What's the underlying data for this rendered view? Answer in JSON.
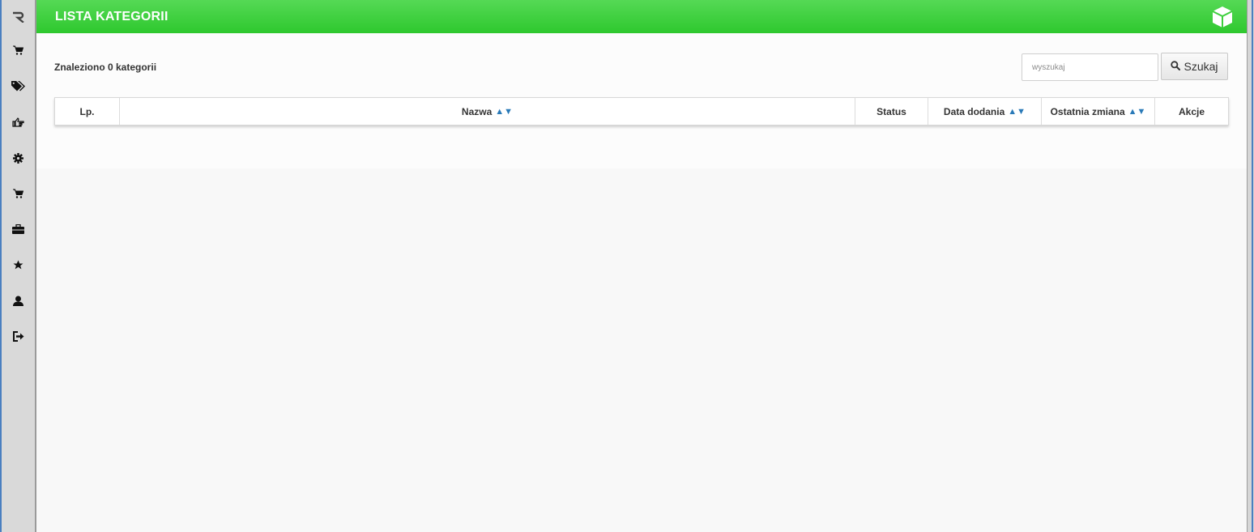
{
  "header": {
    "title": "LISTA KATEGORII",
    "icon": "cube-icon"
  },
  "sidebar": {
    "items": [
      {
        "name": "logo",
        "icon": "logo-r-icon"
      },
      {
        "name": "orders",
        "icon": "cart-icon"
      },
      {
        "name": "tags",
        "icon": "tags-icon"
      },
      {
        "name": "pointer",
        "icon": "hand-pointer-icon"
      },
      {
        "name": "settings",
        "icon": "gear-icon"
      },
      {
        "name": "shop",
        "icon": "cart-icon"
      },
      {
        "name": "briefcase",
        "icon": "briefcase-icon"
      },
      {
        "name": "favorites",
        "icon": "star-icon"
      },
      {
        "name": "user",
        "icon": "user-icon"
      },
      {
        "name": "logout",
        "icon": "logout-icon"
      }
    ]
  },
  "content": {
    "found_text": "Znaleziono 0 kategorii",
    "search": {
      "placeholder": "wyszukaj",
      "value": "",
      "button_label": "Szukaj",
      "icon": "search-icon"
    }
  },
  "table": {
    "columns": [
      {
        "label": "Lp.",
        "sortable": false
      },
      {
        "label": "Nazwa",
        "sortable": true
      },
      {
        "label": "Status",
        "sortable": false
      },
      {
        "label": "Data dodania",
        "sortable": true
      },
      {
        "label": "Ostatnia zmiana",
        "sortable": true
      },
      {
        "label": "Akcje",
        "sortable": false
      }
    ],
    "sort_symbol": "▲▼",
    "rows": []
  },
  "colors": {
    "header_green": "#3dcf3d",
    "sort_blue": "#2a7ab8",
    "sidebar_bg": "#d9d9d9"
  }
}
